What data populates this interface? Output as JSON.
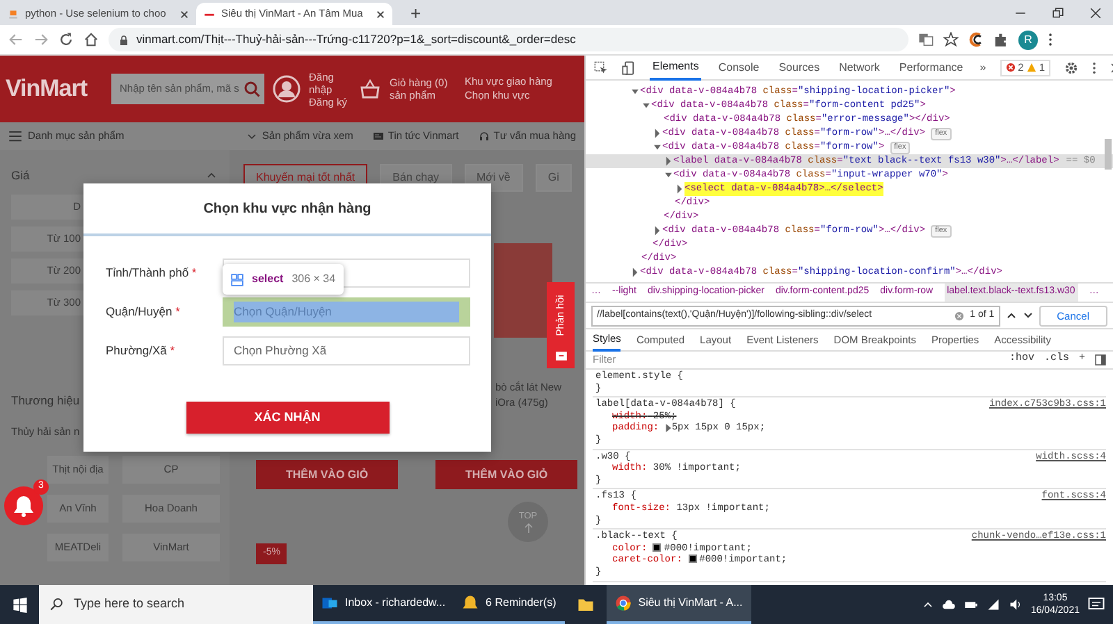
{
  "browser": {
    "tabs": [
      {
        "title": "python - Use selenium to choo",
        "selected": false,
        "kind": "so"
      },
      {
        "title": "Siêu thị VinMart - An Tâm Mua",
        "selected": true,
        "kind": "vinmart"
      }
    ],
    "new_tab": "+",
    "url": "vinmart.com/Thịt---Thuỷ-hải-sản---Trứng-c11720?p=1&_sort=discount&_order=desc",
    "profile": "R"
  },
  "page": {
    "header": {
      "logo": "VinMart",
      "search_placeholder": "Nhập tên sản phẩm, mã s",
      "account": "Đăng nhập Đăng ký",
      "cart": "Giỏ hàng (0) sản phẩm",
      "delivery": "Khu vực giao hàng",
      "delivery_link": "Chọn khu vực"
    },
    "nav": {
      "menu": "Danh mục sản phẩm",
      "links": [
        {
          "label": "Sản phẩm vừa xem",
          "kind": "caret"
        },
        {
          "label": "Tin tức Vinmart",
          "kind": "news"
        },
        {
          "label": "Tư vấn mua hàng",
          "kind": "headset"
        }
      ]
    },
    "sidebar": {
      "price_title": "Giá",
      "price_filters": [
        "D",
        "Từ 100",
        "Từ 200",
        "Từ 300"
      ],
      "brand_title": "Thương hiệu",
      "brand_search": "Thủy hải sản n",
      "brands": [
        "Thịt nội địa",
        "CP",
        "An Vĩnh",
        "Hoa Doanh",
        "MEATDeli",
        "VinMart"
      ]
    },
    "sort_tabs": [
      {
        "label": "Khuyến mại tốt nhất",
        "selected": true
      },
      {
        "label": "Bán chạy",
        "selected": false
      },
      {
        "label": "Mới về",
        "selected": false
      },
      {
        "label": "Gi",
        "selected": false
      }
    ],
    "product_name": "bò cắt lát New\niOra (475g)",
    "add_buttons": [
      "THÊM VÀO GIỎ",
      "THÊM VÀO GIỎ"
    ],
    "discount": "-5%",
    "top": "TOP",
    "feedback": "Phản hồi",
    "notifications": "3",
    "modal": {
      "title": "Chọn khu vực nhận hàng",
      "fields": [
        {
          "label": "Tỉnh/Thành phố",
          "mark": "*",
          "highlighted": false
        },
        {
          "label": "Quận/Huyện",
          "mark": "*",
          "placeholder": "Chọn Quận/Huyện",
          "highlighted": true
        },
        {
          "label": "Phường/Xã",
          "mark": "*",
          "placeholder": "Chọn Phường Xã",
          "highlighted": false
        }
      ],
      "confirm": "XÁC NHẬN"
    },
    "inspect_tooltip": {
      "tag": "select",
      "size": "306 × 34"
    }
  },
  "devtools": {
    "tabs": [
      {
        "label": "Elements",
        "selected": true
      },
      {
        "label": "Console",
        "selected": false
      },
      {
        "label": "Sources",
        "selected": false
      },
      {
        "label": "Network",
        "selected": false
      },
      {
        "label": "Performance",
        "selected": false
      }
    ],
    "more": "»",
    "errors": "2",
    "warnings": "1",
    "tree": [
      {
        "markup": "<div data-v-084a4b78 class=\"shipping-location-picker\">",
        "expanded": true,
        "children": [
          {
            "markup": "<div data-v-084a4b78 class=\"form-content pd25\">",
            "expanded": true,
            "children": [
              {
                "markup": "<div data-v-084a4b78 class=\"error-message\"></div>"
              },
              {
                "markup": "<div data-v-084a4b78 class=\"form-row\">…</div>",
                "expanded": false,
                "badge": "flex"
              },
              {
                "markup": "<div data-v-084a4b78 class=\"form-row\">",
                "expanded": true,
                "badge": "flex",
                "children": [
                  {
                    "markup": "<label data-v-084a4b78 class=\"text black--text fs13 w30\">…</label>",
                    "expanded": false,
                    "selected": true,
                    "suffix": "== $0"
                  },
                  {
                    "markup": "<div data-v-084a4b78 class=\"input-wrapper w70\">",
                    "expanded": true,
                    "children": [
                      {
                        "markup": "<select data-v-084a4b78>…</select>",
                        "expanded": false,
                        "highlighted": true
                      }
                    ],
                    "end": "</div>"
                  }
                ],
                "end": "</div>"
              },
              {
                "markup": "<div data-v-084a4b78 class=\"form-row\">…</div>",
                "expanded": false,
                "badge": "flex"
              }
            ],
            "end": "</div>"
          }
        ],
        "end": "</div>"
      },
      {
        "markup": "<div data-v-084a4b78 class=\"shipping-location-confirm\">…</div>",
        "expanded": false
      }
    ],
    "breadcrumbs": [
      {
        "label": "…",
        "selected": false
      },
      {
        "label": "--light",
        "selected": false
      },
      {
        "label": "div.shipping-location-picker",
        "selected": false
      },
      {
        "label": "div.form-content.pd25",
        "selected": false
      },
      {
        "label": "div.form-row",
        "selected": false
      },
      {
        "label": "label.text.black--text.fs13.w30",
        "selected": true
      },
      {
        "label": "…",
        "selected": false
      }
    ],
    "search": {
      "query": "//label[contains(text(),'Quận/Huyện')]/following-sibling::div/select",
      "count": "1 of 1",
      "cancel": "Cancel"
    },
    "pane_tabs": [
      {
        "label": "Styles",
        "selected": true
      },
      {
        "label": "Computed",
        "selected": false
      },
      {
        "label": "Layout",
        "selected": false
      },
      {
        "label": "Event Listeners",
        "selected": false
      },
      {
        "label": "DOM Breakpoints",
        "selected": false
      },
      {
        "label": "Properties",
        "selected": false
      },
      {
        "label": "Accessibility",
        "selected": false
      }
    ],
    "filter": {
      "placeholder": "Filter",
      "hov": ":hov",
      "cls": ".cls",
      "add": "+"
    },
    "rules": [
      {
        "selector": "element.style {",
        "close": "}"
      },
      {
        "selector": "label[data-v-084a4b78] {",
        "source": "index.c753c9b3.css:1",
        "close": "}",
        "decls": [
          {
            "prop": "width:",
            "value": "25%;",
            "overridden": true
          },
          {
            "prop": "padding:",
            "value": "5px 15px 0 15px;",
            "overridden": false,
            "expander": true
          }
        ]
      },
      {
        "selector": ".w30 {",
        "source": "width.scss:4",
        "close": "}",
        "decls": [
          {
            "prop": "width:",
            "value": "30% !important;",
            "overridden": false
          }
        ]
      },
      {
        "selector": ".fs13 {",
        "source": "font.scss:4",
        "close": "}",
        "decls": [
          {
            "prop": "font-size:",
            "value": "13px !important;",
            "overridden": false
          }
        ]
      },
      {
        "selector": ".black--text {",
        "source": "chunk-vendo…ef13e.css:1",
        "close": "}",
        "decls": [
          {
            "prop": "color:",
            "value": "#000!important;",
            "overridden": false,
            "color": "#000000"
          },
          {
            "prop": "caret-color:",
            "value": "#000!important;",
            "overridden": false,
            "color": "#000000"
          }
        ]
      }
    ]
  },
  "taskbar": {
    "search_placeholder": "Type here to search",
    "apps": [
      {
        "label": "Inbox - richardedw...",
        "kind": "mail",
        "selected": false
      },
      {
        "label": "6 Reminder(s)",
        "kind": "bell",
        "selected": false
      },
      {
        "kind": "folder",
        "selected": false
      },
      {
        "label": "Siêu thị VinMart - A...",
        "kind": "browser",
        "selected": true
      }
    ],
    "time": "13:05",
    "date": "16/04/2021"
  }
}
